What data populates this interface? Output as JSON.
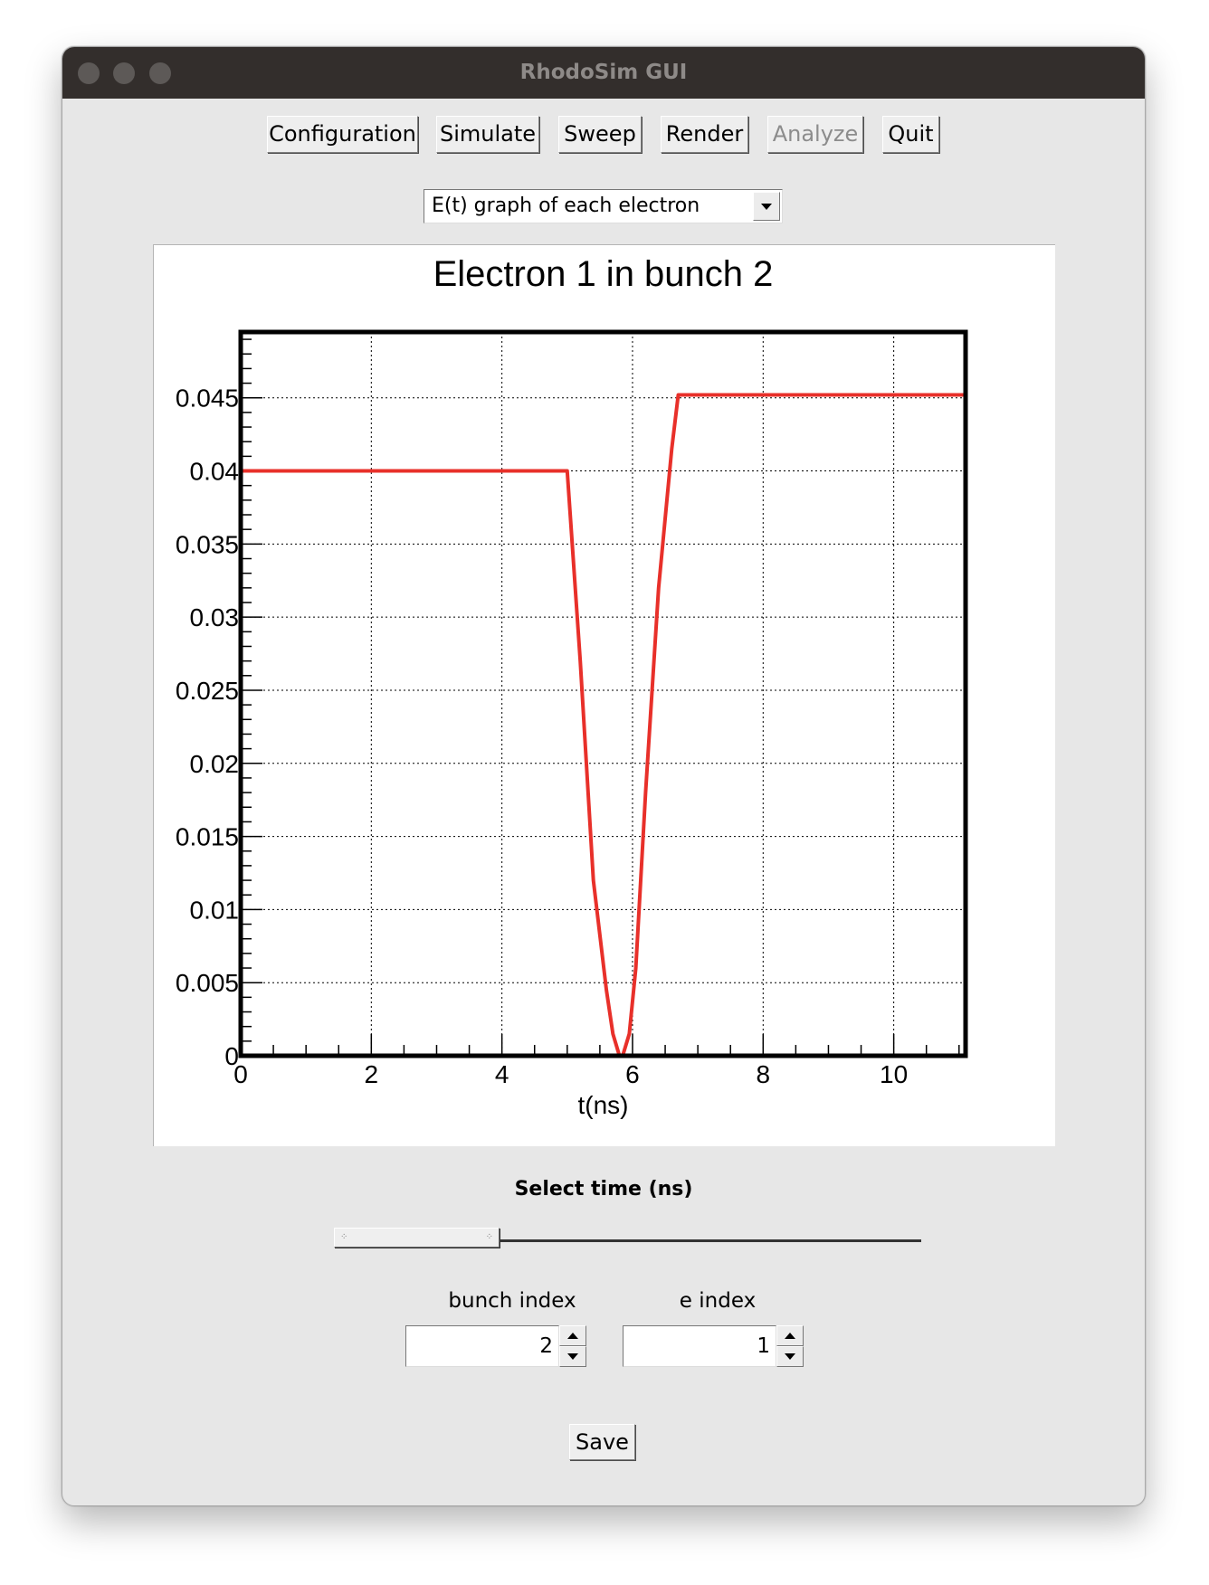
{
  "window": {
    "title": "RhodoSim GUI"
  },
  "toolbar": {
    "buttons": [
      {
        "label": "Configuration",
        "enabled": true
      },
      {
        "label": "Simulate",
        "enabled": true
      },
      {
        "label": "Sweep",
        "enabled": true
      },
      {
        "label": "Render",
        "enabled": true
      },
      {
        "label": "Analyze",
        "enabled": false
      },
      {
        "label": "Quit",
        "enabled": true
      }
    ]
  },
  "plot_selector": {
    "selected": "E(t) graph of each electron"
  },
  "chart_data": {
    "type": "line",
    "title": "Electron 1 in bunch 2",
    "xlabel": "t(ns)",
    "ylabel": "",
    "xlim": [
      0,
      11.1
    ],
    "ylim": [
      0,
      0.0495
    ],
    "grid": true,
    "x_ticks": [
      0,
      2,
      4,
      6,
      8,
      10
    ],
    "x_tick_labels": [
      "0",
      "2",
      "4",
      "6",
      "8",
      "10"
    ],
    "y_ticks": [
      0,
      0.005,
      0.01,
      0.015,
      0.02,
      0.025,
      0.03,
      0.035,
      0.04,
      0.045
    ],
    "y_tick_labels": [
      "0",
      "0.005",
      "0.01",
      "0.015",
      "0.02",
      "0.025",
      "0.03",
      "0.035",
      "0.04",
      "0.045"
    ],
    "series": [
      {
        "color": "#e8302a",
        "x": [
          0,
          0,
          5.0,
          5.2,
          5.4,
          5.6,
          5.7,
          5.8,
          5.85,
          5.95,
          6.05,
          6.2,
          6.4,
          6.6,
          6.7,
          11.1
        ],
        "y": [
          0,
          0.04,
          0.04,
          0.027,
          0.012,
          0.0045,
          0.0015,
          0.0,
          0.0,
          0.0015,
          0.006,
          0.018,
          0.032,
          0.0415,
          0.0452,
          0.0452
        ]
      }
    ]
  },
  "time_slider": {
    "label": "Select time (ns)",
    "value_fraction": 0.32
  },
  "bunch_index": {
    "label": "bunch index",
    "value": "2"
  },
  "e_index": {
    "label": "e index",
    "value": "1"
  },
  "save": {
    "label": "Save"
  }
}
